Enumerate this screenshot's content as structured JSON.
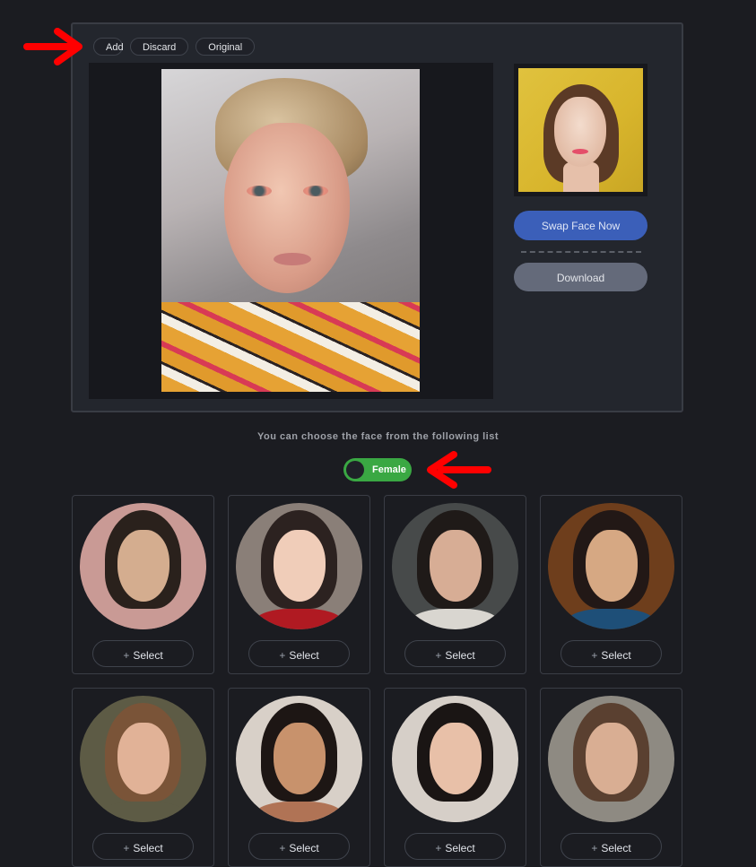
{
  "toolbar": {
    "add_label": "Add",
    "discard_label": "Discard",
    "original_label": "Original"
  },
  "editor": {
    "main_photo_alt": "Source photo of blonde woman with orange scarf",
    "target_face_alt": "Target face of woman on yellow background"
  },
  "actions": {
    "swap_label": "Swap Face Now",
    "download_label": "Download"
  },
  "colors": {
    "swap": "#3b5fb9",
    "download": "#646a7a",
    "toggle": "#3aa843",
    "annotation_arrow": "#ff0000"
  },
  "face_list": {
    "hint": "You can choose the face from the following list",
    "gender_toggle": {
      "label": "Female",
      "on": true
    },
    "select_label": "Select",
    "faces": [
      {
        "name": "face-1",
        "bg": "#c99a95",
        "hair": "#2a211c",
        "skin": "#d4ad8f",
        "body": "#c99a95"
      },
      {
        "name": "face-2",
        "bg": "#8a7f78",
        "hair": "#2c2220",
        "skin": "#f0cdb9",
        "body": "#b01a22"
      },
      {
        "name": "face-3",
        "bg": "#474a4a",
        "hair": "#1f1a18",
        "skin": "#d7ad95",
        "body": "#d9d6d0"
      },
      {
        "name": "face-4",
        "bg": "#6e3e1c",
        "hair": "#221816",
        "skin": "#d6a883",
        "body": "#1e4f78"
      },
      {
        "name": "face-5",
        "bg": "#5d5b45",
        "hair": "#7a5438",
        "skin": "#e1b297",
        "body": "#5d5b45"
      },
      {
        "name": "face-6",
        "bg": "#d8d0c8",
        "hair": "#1d1614",
        "skin": "#c8926c",
        "body": "#b07355"
      },
      {
        "name": "face-7",
        "bg": "#d6cfc8",
        "hair": "#1a1514",
        "skin": "#e8c0a8",
        "body": "#d6cfc8"
      },
      {
        "name": "face-8",
        "bg": "#8e8a82",
        "hair": "#5a4030",
        "skin": "#d9ae93",
        "body": "#8e8a82"
      }
    ]
  }
}
